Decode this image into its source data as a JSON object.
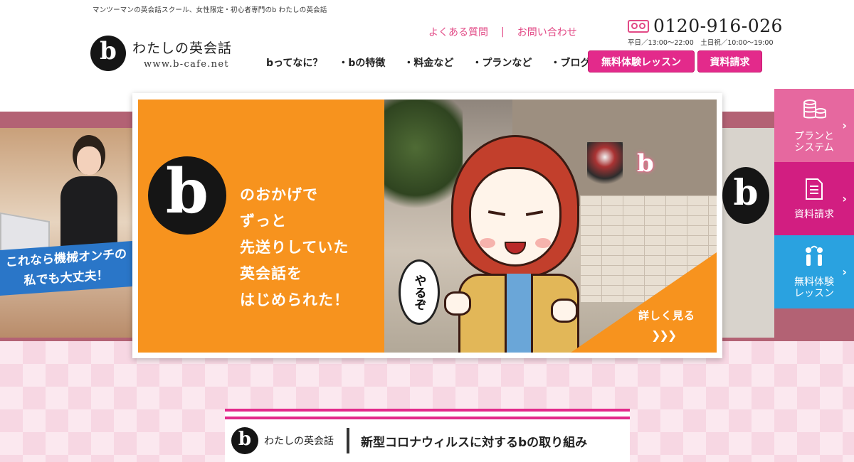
{
  "header": {
    "tagline": "マンツーマンの英会話スクール、女性限定・初心者専門のb わたしの英会話",
    "logo": {
      "mark": "b",
      "name": "わたしの英会話",
      "url": "www.b-cafe.net"
    },
    "util_links": [
      "よくある質問",
      "|",
      "お問い合わせ"
    ],
    "phone": {
      "number": "0120-916-026",
      "hours": "平日／13:00～22:00　土日祝／10:00～19:00"
    },
    "nav": [
      "bってなに？",
      "・bの特徴",
      "・料金など",
      "・プランなど",
      "・ブログ"
    ],
    "cta_trial": "無料体験レッスン",
    "cta_docs": "資料請求"
  },
  "slider": {
    "mark": "b",
    "copy_lines": [
      "のおかげで",
      "ずっと",
      "先送りしていた",
      "英会話を",
      "はじめられた！"
    ],
    "speech": "やるぞ",
    "more_label": "詳しく見る",
    "more_arrows": "❯❯❯",
    "photo_neon": "b",
    "left_banner_lines": [
      "これなら機械オンチの",
      "私でも大丈夫！"
    ],
    "right_mark": "b"
  },
  "side_menu": [
    {
      "label": "プランと\nシステム",
      "icon": "coins-icon",
      "glyph": "🪙",
      "color": "#e6689f"
    },
    {
      "label": "資料請求",
      "icon": "document-icon",
      "glyph": "📄",
      "color": "#d21e81"
    },
    {
      "label": "無料体験\nレッスン",
      "icon": "people-icon",
      "glyph": "👥",
      "color": "#2aa2e0"
    }
  ],
  "notice": {
    "logo_mark": "b",
    "logo_text": "わたしの英会話",
    "title": "新型コロナウィルスに対するbの取り組み"
  },
  "colors": {
    "accent": "#e32a8b",
    "orange": "#f7931e",
    "band": "#b36274",
    "blue": "#2aa2e0"
  }
}
